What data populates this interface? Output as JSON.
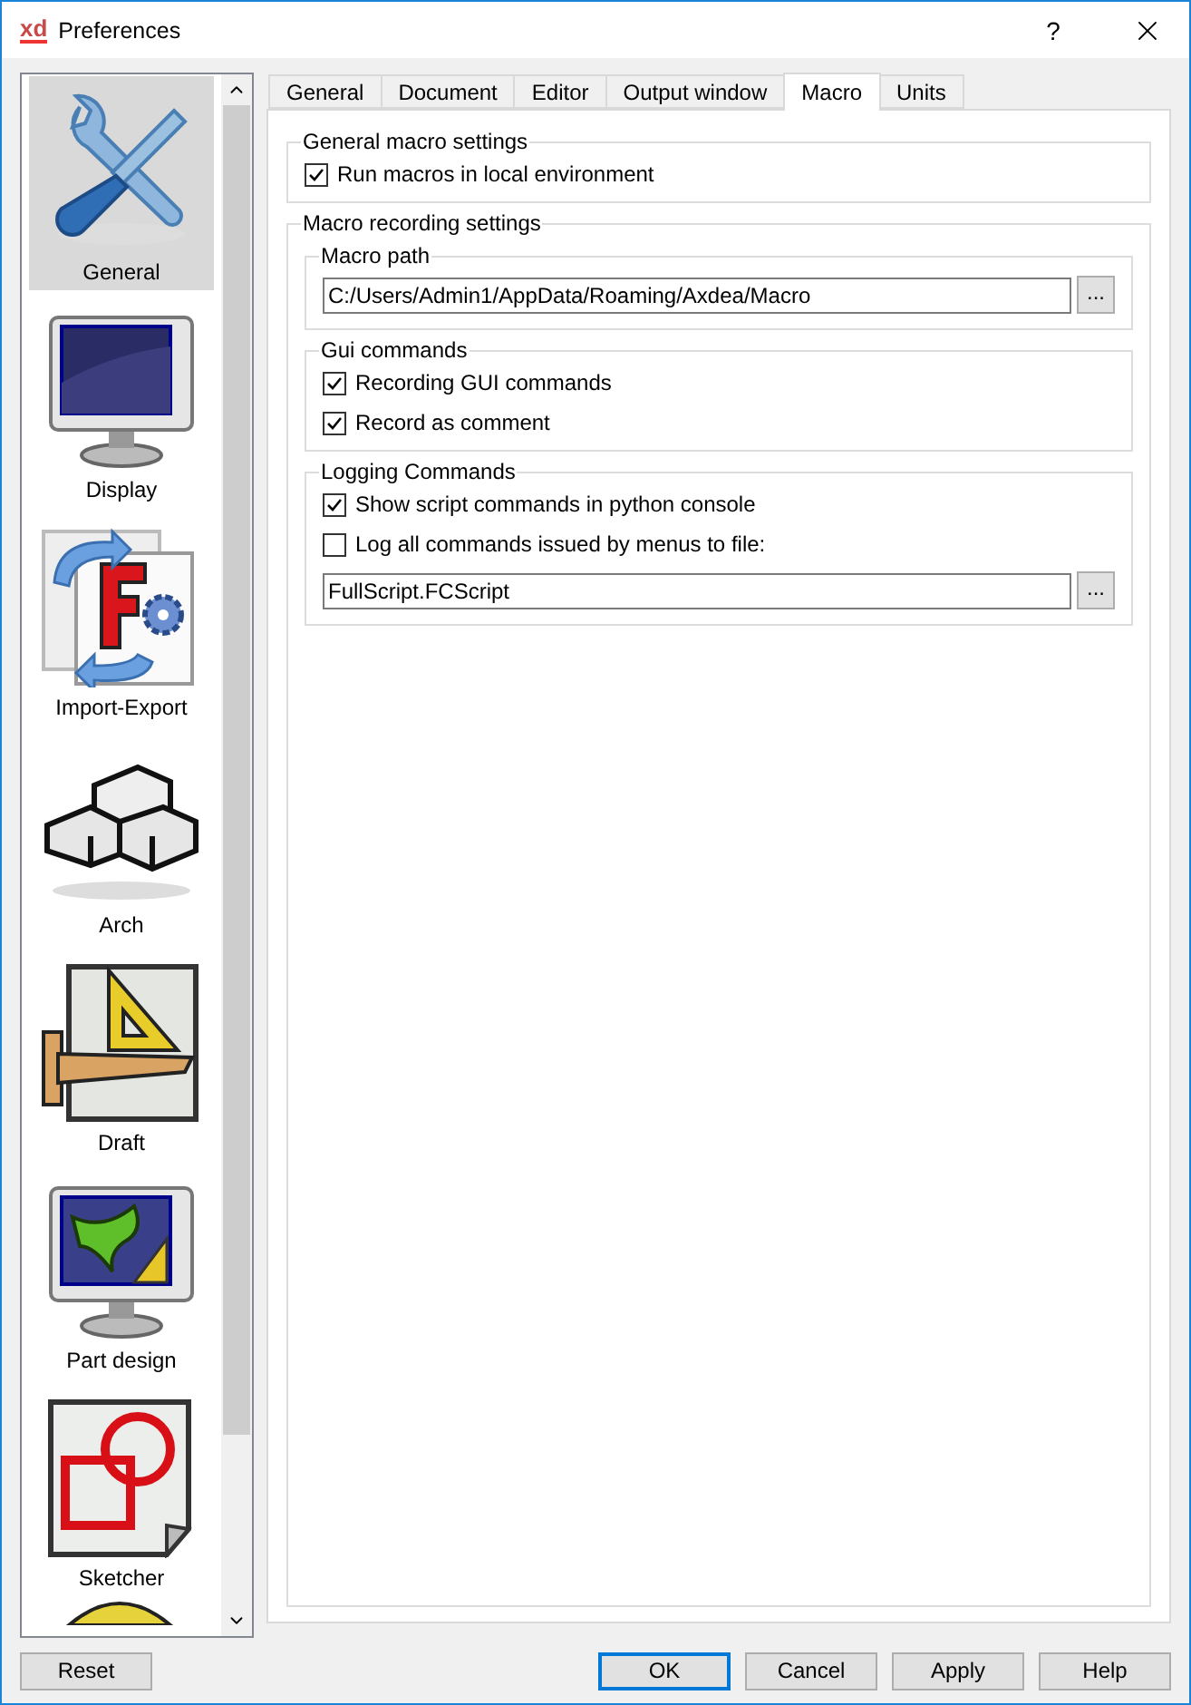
{
  "window": {
    "logo": "xd",
    "title": "Preferences",
    "help": "?"
  },
  "categories": [
    {
      "label": "General",
      "selected": true
    },
    {
      "label": "Display",
      "selected": false
    },
    {
      "label": "Import-Export",
      "selected": false
    },
    {
      "label": "Arch",
      "selected": false
    },
    {
      "label": "Draft",
      "selected": false
    },
    {
      "label": "Part design",
      "selected": false
    },
    {
      "label": "Sketcher",
      "selected": false
    }
  ],
  "tabs": [
    {
      "label": "General",
      "selected": false
    },
    {
      "label": "Document",
      "selected": false
    },
    {
      "label": "Editor",
      "selected": false
    },
    {
      "label": "Output window",
      "selected": false
    },
    {
      "label": "Macro",
      "selected": true
    },
    {
      "label": "Units",
      "selected": false
    }
  ],
  "general_macro_settings": {
    "title": "General macro settings",
    "options": [
      {
        "label": "Run macros in local environment",
        "checked": true
      }
    ]
  },
  "macro_recording_settings": {
    "title": "Macro recording settings",
    "macro_path": {
      "title": "Macro path",
      "value": "C:/Users/Admin1/AppData/Roaming/Axdea/Macro",
      "browse": "..."
    },
    "gui_commands": {
      "title": "Gui commands",
      "options": [
        {
          "label": "Recording GUI commands",
          "checked": true
        },
        {
          "label": "Record as comment",
          "checked": true
        }
      ]
    },
    "logging_commands": {
      "title": "Logging Commands",
      "options": [
        {
          "label": "Show script commands in python console",
          "checked": true
        },
        {
          "label": "Log all commands issued by menus to file:",
          "checked": false
        }
      ],
      "file": {
        "value": "FullScript.FCScript",
        "browse": "..."
      }
    }
  },
  "buttons": [
    {
      "label": "Reset",
      "kind": "left",
      "default": false
    },
    {
      "label": "OK",
      "kind": "right",
      "default": true
    },
    {
      "label": "Cancel",
      "kind": "right",
      "default": false
    },
    {
      "label": "Apply",
      "kind": "right",
      "default": false
    },
    {
      "label": "Help",
      "kind": "right",
      "default": false
    }
  ]
}
